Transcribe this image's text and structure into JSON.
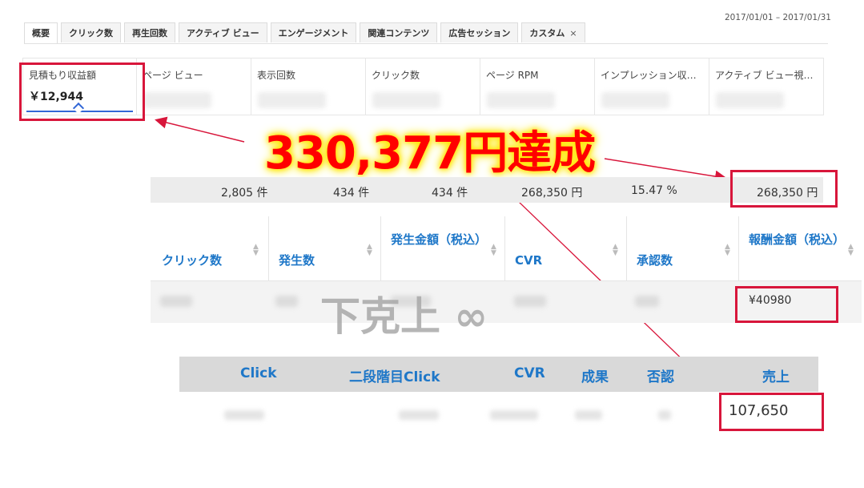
{
  "date_range": "2017/01/01 – 2017/01/31",
  "tabs": [
    {
      "label": "概要",
      "active": true
    },
    {
      "label": "クリック数"
    },
    {
      "label": "再生回数"
    },
    {
      "label": "アクティブ ビュー"
    },
    {
      "label": "エンゲージメント"
    },
    {
      "label": "関連コンテンツ"
    },
    {
      "label": "広告セッション"
    },
    {
      "label": "カスタム",
      "close": "×"
    }
  ],
  "metrics": [
    {
      "label": "見積もり収益額",
      "value": "￥12,944"
    },
    {
      "label": "ページ ビュー"
    },
    {
      "label": "表示回数"
    },
    {
      "label": "クリック数"
    },
    {
      "label": "ページ RPM"
    },
    {
      "label": "インプレッション収…"
    },
    {
      "label": "アクティブ ビュー視…"
    }
  ],
  "headline": "330,377円達成",
  "summary": [
    "2,805 件",
    "434 件",
    "434 件",
    "268,350 円",
    "15.47 %",
    "268,350 円"
  ],
  "table1": {
    "headers": [
      "クリック数",
      "発生数",
      "発生金額（税込）",
      "CVR",
      "承認数",
      "報酬金額（税込）"
    ],
    "reward_value": "¥40980"
  },
  "watermark": "下克上 ∞",
  "table2": {
    "headers": [
      "Click",
      "二段階目Click",
      "CVR",
      "成果",
      "否認",
      "売上"
    ],
    "sales_value": "107,650"
  },
  "colors": {
    "accent_red": "#d8163b",
    "link_blue": "#1e77c8",
    "underline_blue": "#3367d6",
    "headline_red": "#ff0000",
    "glow": "#ffe600"
  }
}
